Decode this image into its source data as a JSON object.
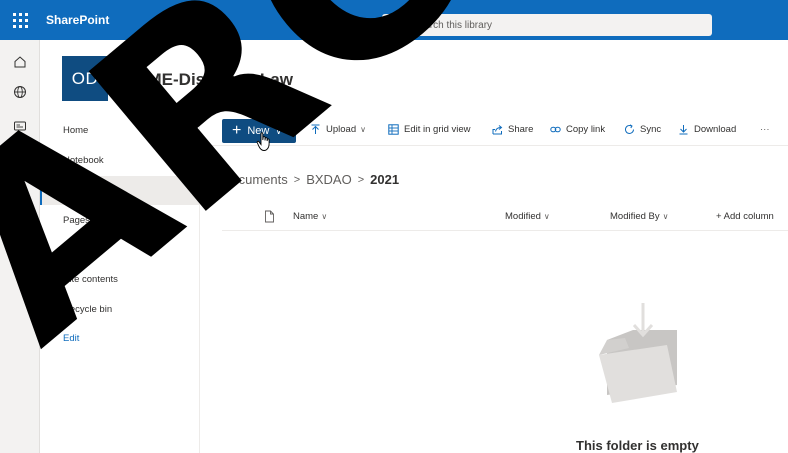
{
  "suite": {
    "brand": "SharePoint",
    "search_placeholder": "Search this library",
    "color": "#0f6cbd"
  },
  "site": {
    "logo_text": "OD",
    "title": "OCME-DiscoveryLaw"
  },
  "leftnav": {
    "items": [
      {
        "label": "Home",
        "selected": false
      },
      {
        "label": "Notebook",
        "selected": false
      },
      {
        "label": "Documents",
        "selected": true
      },
      {
        "label": "Pages",
        "selected": false
      },
      {
        "label": "2021",
        "selected": false
      },
      {
        "label": "Site contents",
        "selected": false
      },
      {
        "label": "Recycle bin",
        "selected": false
      },
      {
        "label": "Edit",
        "selected": false
      }
    ]
  },
  "commandbar": {
    "new_label": "New",
    "upload_label": "Upload",
    "grid_label": "Edit in grid view",
    "share_label": "Share",
    "copylink_label": "Copy link",
    "sync_label": "Sync",
    "download_label": "Download",
    "more_label": "···"
  },
  "breadcrumb": {
    "items": [
      "Documents",
      "BXDAO",
      "2021"
    ],
    "separator": ">"
  },
  "columns": {
    "name": "Name",
    "modified": "Modified",
    "modified_by": "Modified By",
    "add_column": "+ Add column"
  },
  "empty_state": {
    "text": "This folder is empty"
  },
  "watermark": {
    "text": "ARC",
    "color": "#000000"
  },
  "icons": {
    "appbar": [
      "home-icon",
      "globe-icon",
      "news-icon",
      "file-icon",
      "list-icon"
    ]
  }
}
